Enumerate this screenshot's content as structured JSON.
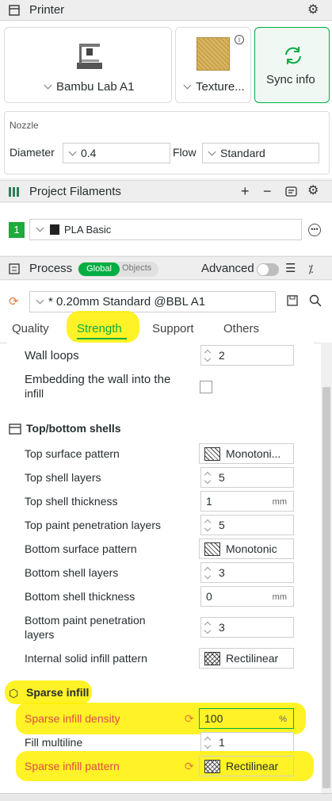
{
  "printer": {
    "title": "Printer",
    "machine_name": "Bambu Lab A1",
    "plate_name": "Texture...",
    "sync_label": "Sync info",
    "nozzle_label": "Nozzle",
    "diameter_label": "Diameter",
    "diameter_value": "0.4",
    "flow_label": "Flow",
    "flow_value": "Standard"
  },
  "filaments": {
    "title": "Project Filaments",
    "items": [
      {
        "index": "1",
        "name": "PLA Basic",
        "color": "#1faa3c"
      }
    ]
  },
  "process": {
    "title": "Process",
    "toggle_global": "Global",
    "toggle_objects": "Objects",
    "advanced_label": "Advanced",
    "preset": "* 0.20mm Standard @BBL A1",
    "tabs": [
      "Quality",
      "Strength",
      "Support",
      "Others"
    ],
    "active_tab": "Strength",
    "accent_color": "#00ae42",
    "warn_color": "#e24a4a"
  },
  "settings": {
    "wall_loops_label": "Wall loops",
    "wall_loops_value": "2",
    "embed_wall_label_1": "Embedding the wall into the",
    "embed_wall_label_2": "infill",
    "topbottom_title": "Top/bottom shells",
    "top_surface_pattern_label": "Top surface pattern",
    "top_surface_pattern_value": "Monotoni...",
    "top_shell_layers_label": "Top shell layers",
    "top_shell_layers_value": "5",
    "top_shell_thickness_label": "Top shell thickness",
    "top_shell_thickness_value": "1",
    "top_shell_thickness_unit": "mm",
    "top_paint_label": "Top paint penetration layers",
    "top_paint_value": "5",
    "bottom_surface_pattern_label": "Bottom surface pattern",
    "bottom_surface_pattern_value": "Monotonic",
    "bottom_shell_layers_label": "Bottom shell layers",
    "bottom_shell_layers_value": "3",
    "bottom_shell_thickness_label": "Bottom shell thickness",
    "bottom_shell_thickness_value": "0",
    "bottom_shell_thickness_unit": "mm",
    "bottom_paint_label_1": "Bottom paint penetration",
    "bottom_paint_label_2": "layers",
    "bottom_paint_value": "3",
    "internal_solid_label": "Internal solid infill pattern",
    "internal_solid_value": "Rectilinear",
    "sparse_title": "Sparse infill",
    "sparse_density_label": "Sparse infill density",
    "sparse_density_value": "100",
    "sparse_density_unit": "%",
    "fill_multiline_label": "Fill multiline",
    "fill_multiline_value": "1",
    "sparse_pattern_label": "Sparse infill pattern",
    "sparse_pattern_value": "Rectilinear"
  }
}
